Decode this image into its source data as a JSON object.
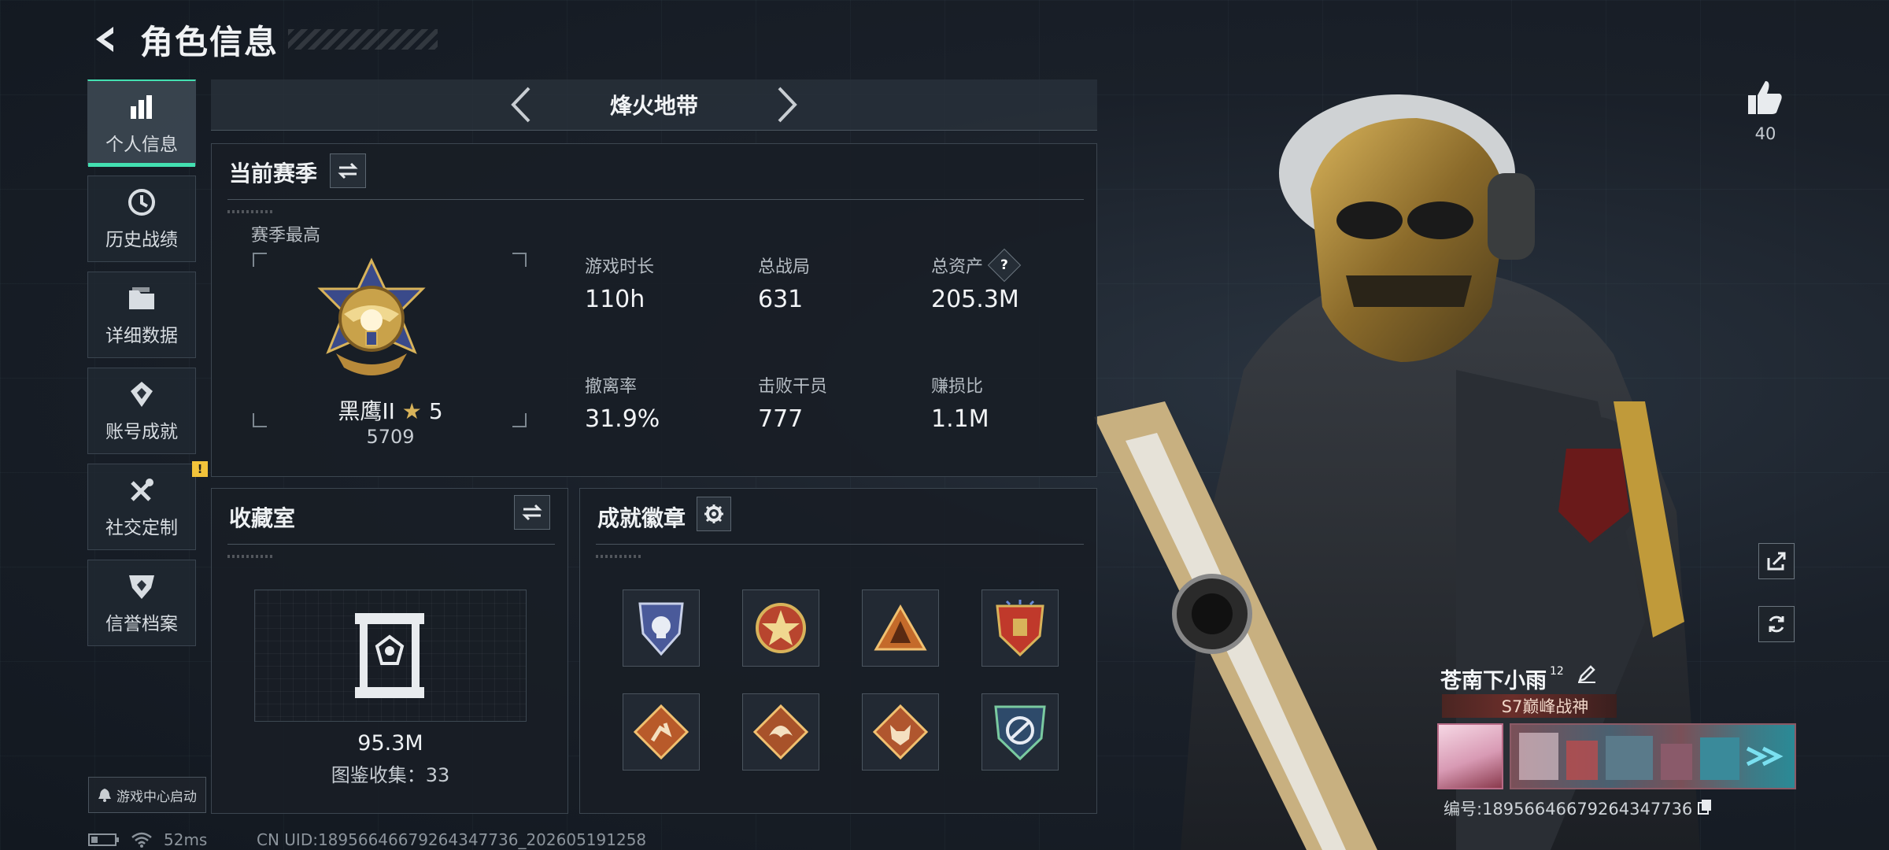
{
  "header": {
    "title": "角色信息"
  },
  "sidenav": {
    "items": [
      {
        "label": "个人信息",
        "icon": "bar-chart-icon",
        "active": true
      },
      {
        "label": "历史战绩",
        "icon": "history-clock-icon",
        "active": false
      },
      {
        "label": "详细数据",
        "icon": "folder-icon",
        "active": false
      },
      {
        "label": "账号成就",
        "icon": "achievement-icon",
        "active": false
      },
      {
        "label": "社交定制",
        "icon": "tools-icon",
        "active": false,
        "badge": "!"
      },
      {
        "label": "信誉档案",
        "icon": "credit-shield-icon",
        "active": false
      }
    ],
    "launch_label": "游戏中心启动"
  },
  "mode": {
    "name": "烽火地带"
  },
  "season": {
    "title": "当前赛季",
    "subtitle": "赛季最高",
    "rank_name": "黑鹰II",
    "rank_stars": "5",
    "rank_score": "5709",
    "stats": [
      {
        "label": "游戏时长",
        "value": "110h"
      },
      {
        "label": "总战局",
        "value": "631"
      },
      {
        "label": "总资产",
        "value": "205.3M",
        "help": "?"
      },
      {
        "label": "撤离率",
        "value": "31.9%"
      },
      {
        "label": "击败干员",
        "value": "777"
      },
      {
        "label": "赚损比",
        "value": "1.1M"
      }
    ]
  },
  "collection": {
    "title": "收藏室",
    "value": "95.3M",
    "count_label": "图鉴收集：33"
  },
  "badges": {
    "title": "成就徽章",
    "items": [
      {
        "icon": "skull-shield-badge-icon",
        "color": "#4a5a9a"
      },
      {
        "icon": "star-roundel-badge-icon",
        "color": "#b8452e"
      },
      {
        "icon": "tent-triangle-badge-icon",
        "color": "#c46a2a"
      },
      {
        "icon": "star-shield-badge-icon",
        "color": "#c0392b"
      },
      {
        "icon": "runner-diamond-badge-icon",
        "color": "#b85a2a"
      },
      {
        "icon": "dragon-diamond-badge-icon",
        "color": "#a8522a"
      },
      {
        "icon": "wolf-diamond-badge-icon",
        "color": "#b0562e"
      },
      {
        "icon": "eagle-shield-badge-icon",
        "color": "#3a7a5a"
      }
    ]
  },
  "profile": {
    "likes": "40",
    "name": "苍南下小雨",
    "level": "12",
    "title_tag": "S7巅峰战神",
    "id_label": "编号:18956646679264347736"
  },
  "status": {
    "ping": "52ms",
    "uid": "CN UID:18956646679264347736_202605191258"
  },
  "colors": {
    "accent": "#43e0b1",
    "panel_bg": "#181e26",
    "warning": "#f2c33a"
  }
}
